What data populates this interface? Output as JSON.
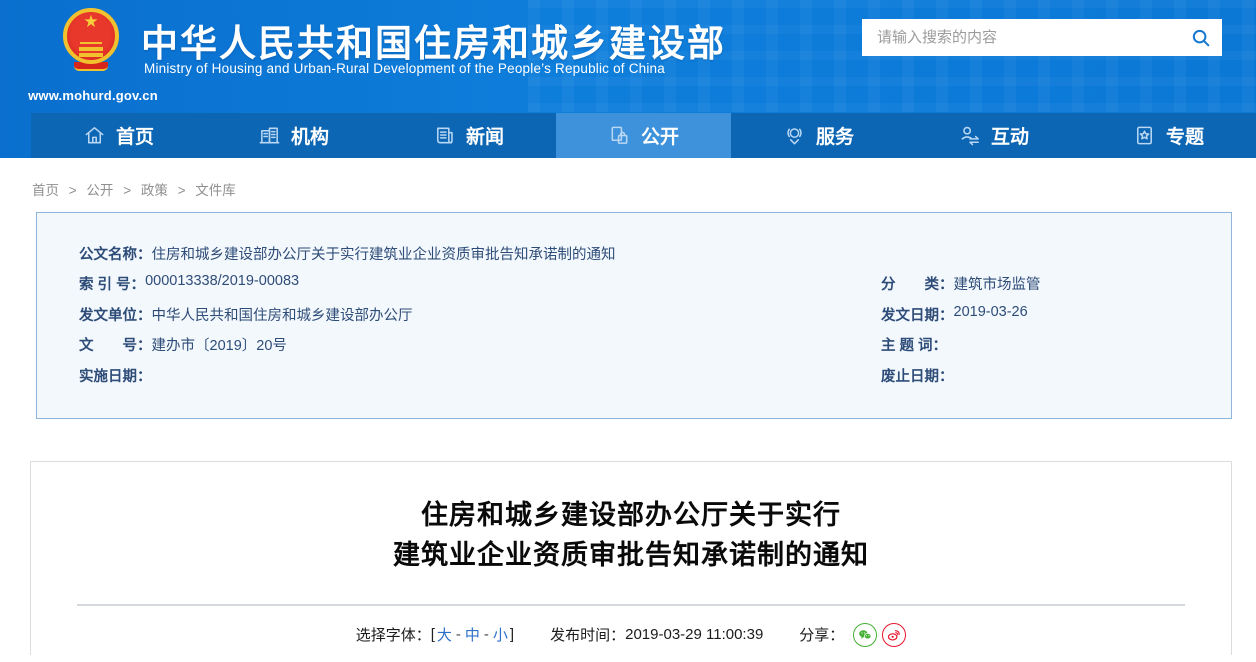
{
  "site": {
    "url": "www.mohurd.gov.cn",
    "title": "中华人民共和国住房和城乡建设部",
    "subtitle": "Ministry of Housing and Urban-Rural Development of the People’s Republic of China"
  },
  "search": {
    "placeholder": "请输入搜索的内容"
  },
  "nav": {
    "items": [
      "首页",
      "机构",
      "新闻",
      "公开",
      "服务",
      "互动",
      "专题"
    ]
  },
  "breadcrumb": {
    "separator": ">",
    "items": [
      "首页",
      "公开",
      "政策",
      "文件库"
    ]
  },
  "meta": {
    "name_label": "公文名称：",
    "name_value": "住房和城乡建设部办公厅关于实行建筑业企业资质审批告知承诺制的通知",
    "rows": [
      {
        "l_label": "索 引 号：",
        "l_value": "000013338/2019-00083",
        "r_label": "分　　类：",
        "r_value": "建筑市场监管"
      },
      {
        "l_label": "发文单位：",
        "l_value": "中华人民共和国住房和城乡建设部办公厅",
        "r_label": "发文日期：",
        "r_value": "2019-03-26"
      },
      {
        "l_label": "文　　号：",
        "l_value": "建办市〔2019〕20号",
        "r_label": "主 题 词：",
        "r_value": ""
      },
      {
        "l_label": "实施日期：",
        "l_value": "",
        "r_label": "废止日期：",
        "r_value": ""
      }
    ]
  },
  "doc": {
    "title_line1": "住房和城乡建设部办公厅关于实行",
    "title_line2": "建筑业企业资质审批告知承诺制的通知",
    "font_select": {
      "label": "选择字体：",
      "open": "[",
      "close": "]",
      "sep": "-",
      "large": "大",
      "medium": "中",
      "small": "小"
    },
    "publish_label": "发布时间：",
    "publish_time": "2019-03-29 11:00:39",
    "share_label": "分享："
  },
  "colors": {
    "header_blue": "#0d7bd8",
    "nav_blue": "#0d66b4",
    "nav_active_blue": "#3e92db",
    "meta_bg": "#f3f8fd",
    "meta_border": "#8fb6da",
    "meta_text": "#2e4c78",
    "link_blue": "#2e6fc8",
    "wechat_green": "#45b035",
    "weibo_red": "#e6162d"
  }
}
